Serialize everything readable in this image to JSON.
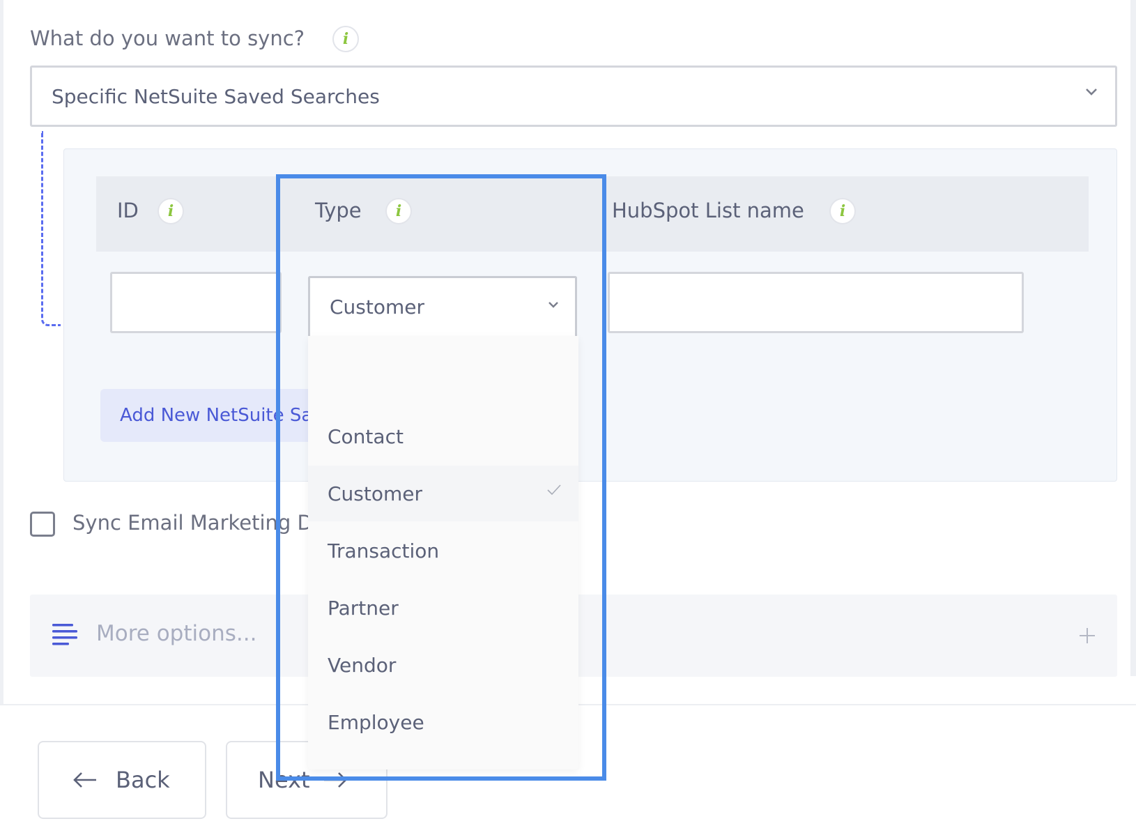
{
  "sync": {
    "label": "What do you want to sync?",
    "selected": "Specific NetSuite Saved Searches"
  },
  "table": {
    "columns": {
      "id": "ID",
      "type": "Type",
      "list_name": "HubSpot List name"
    },
    "row": {
      "id_value": "",
      "type_value": "Customer",
      "list_name_value": ""
    },
    "add_button": "Add New NetSuite Sa"
  },
  "type_dropdown": {
    "options": [
      "",
      "Contact",
      "Customer",
      "Transaction",
      "Partner",
      "Vendor",
      "Employee"
    ],
    "selected": "Customer"
  },
  "email_marketing": {
    "label": "Sync Email Marketing D",
    "checked": false
  },
  "more_options": {
    "label": "More options..."
  },
  "footer": {
    "back": "Back",
    "next": "Next"
  },
  "colors": {
    "accent": "#4a59d6",
    "info_green": "#8cc63f",
    "highlight": "#4a8be8"
  }
}
